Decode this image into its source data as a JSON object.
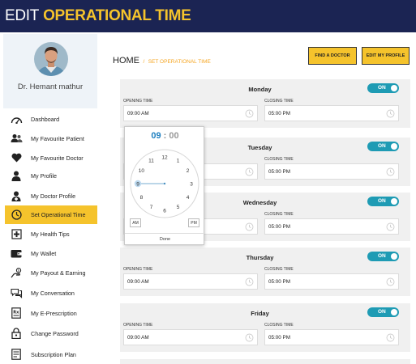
{
  "header": {
    "title_prefix": "EDIT",
    "title_highlight": "OPERATIONAL TIME"
  },
  "sidebar": {
    "doctor_name": "Dr. Hemant mathur",
    "items": [
      {
        "label": "Dashboard",
        "icon": "gauge-icon"
      },
      {
        "label": "My Favourite Patient",
        "icon": "users-icon"
      },
      {
        "label": "My Favourite Doctor",
        "icon": "heart-icon"
      },
      {
        "label": "My Profile",
        "icon": "user-icon"
      },
      {
        "label": "My Doctor Profile",
        "icon": "doctor-icon"
      },
      {
        "label": "Set Operational Time",
        "icon": "clock-icon",
        "active": true
      },
      {
        "label": "My Health Tips",
        "icon": "health-tips-icon"
      },
      {
        "label": "My Wallet",
        "icon": "wallet-icon"
      },
      {
        "label": "My Payout & Earning",
        "icon": "payout-icon"
      },
      {
        "label": "My Conversation",
        "icon": "chat-icon"
      },
      {
        "label": "My E-Prescription",
        "icon": "prescription-icon"
      },
      {
        "label": "Change Password",
        "icon": "lock-icon"
      },
      {
        "label": "Subscription Plan",
        "icon": "subscription-icon"
      }
    ]
  },
  "breadcrumb": {
    "home": "HOME",
    "separator": "/",
    "current": "SET OPERATIONAL TIME"
  },
  "actions": {
    "find_doctor": "FIND A DOCTOR",
    "edit_profile": "EDIT MY PROFILE"
  },
  "schedule": {
    "opening_label": "OPENING TIME",
    "closing_label": "CLOSING TIME",
    "days": [
      {
        "name": "Monday",
        "status": "ON",
        "opening": "09:00 AM",
        "closing": "05:00 PM"
      },
      {
        "name": "Tuesday",
        "status": "ON",
        "opening": "",
        "closing": "05:00 PM"
      },
      {
        "name": "Wednesday",
        "status": "ON",
        "opening": "",
        "closing": "05:00 PM"
      },
      {
        "name": "Thursday",
        "status": "ON",
        "opening": "09:00 AM",
        "closing": "05:00 PM"
      },
      {
        "name": "Friday",
        "status": "ON",
        "opening": "09:00 AM",
        "closing": "05:00 PM"
      }
    ]
  },
  "time_picker": {
    "hours": "09",
    "separator": ":",
    "minutes": "00",
    "dial_numbers": [
      "12",
      "1",
      "2",
      "3",
      "4",
      "5",
      "6",
      "7",
      "8",
      "9",
      "10",
      "11"
    ],
    "selected_hour": "9",
    "am_label": "AM",
    "pm_label": "PM",
    "done_label": "Done"
  },
  "colors": {
    "navy": "#1b2453",
    "accent_yellow": "#f5c32c",
    "toggle_teal": "#1e9bb4",
    "picker_blue": "#1e7fc0"
  }
}
